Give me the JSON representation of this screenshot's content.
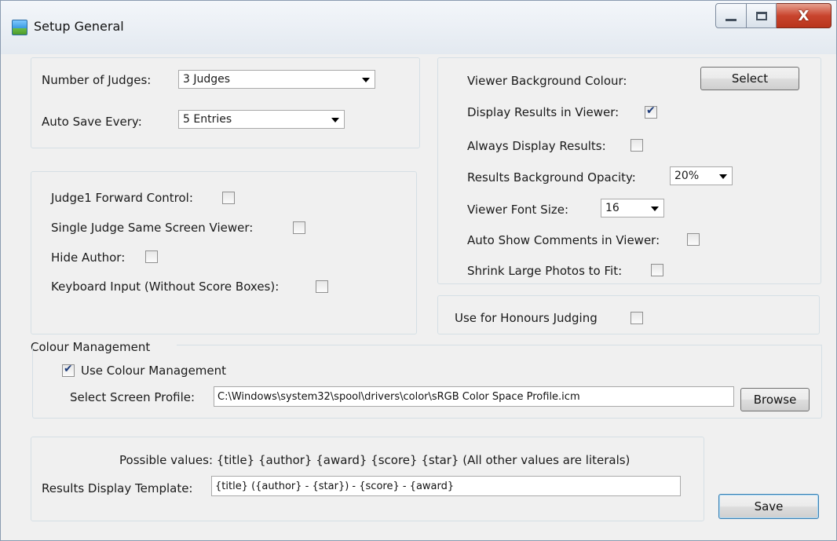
{
  "window": {
    "title": "Setup General",
    "controls": {
      "minimize": "minimize",
      "maximize": "maximize",
      "close": "X"
    }
  },
  "judges_group": {
    "number_of_judges_label": "Number of Judges:",
    "number_of_judges_value": "3 Judges",
    "auto_save_label": "Auto Save Every:",
    "auto_save_value": "5 Entries"
  },
  "options_group": {
    "judge1_forward_label": "Judge1 Forward Control:",
    "judge1_forward_checked": false,
    "single_judge_label": "Single Judge Same Screen Viewer:",
    "single_judge_checked": false,
    "hide_author_label": "Hide Author:",
    "hide_author_checked": false,
    "keyboard_input_label": "Keyboard Input (Without Score Boxes):",
    "keyboard_input_checked": false
  },
  "viewer_group": {
    "bg_colour_label": "Viewer Background Colour:",
    "select_button": "Select",
    "display_results_label": "Display Results in Viewer:",
    "display_results_checked": true,
    "always_display_label": "Always Display Results:",
    "always_display_checked": false,
    "opacity_label": "Results Background Opacity:",
    "opacity_value": "20%",
    "font_size_label": "Viewer Font Size:",
    "font_size_value": "16",
    "auto_comments_label": "Auto Show Comments in Viewer:",
    "auto_comments_checked": false,
    "shrink_label": "Shrink Large Photos to Fit:",
    "shrink_checked": false
  },
  "honours_group": {
    "label": "Use for Honours Judging",
    "checked": false
  },
  "colour_management": {
    "group_title": "Colour Management",
    "use_label": "Use Colour Management",
    "use_checked": true,
    "profile_label": "Select Screen Profile:",
    "profile_value": "C:\\Windows\\system32\\spool\\drivers\\color\\sRGB Color Space Profile.icm",
    "browse_button": "Browse"
  },
  "template_group": {
    "possible_values": "Possible values: {title}  {author}  {award}  {score} {star}  (All other values are literals)",
    "template_label": "Results Display Template:",
    "template_value": "{title} ({author} - {star}) - {score} - {award}"
  },
  "save_button": "Save",
  "colors": {
    "window_bg": "#f0f0f0",
    "group_border": "#d5dfe5",
    "close_button": "#c9452e",
    "check_mark": "#1e3c7a"
  }
}
